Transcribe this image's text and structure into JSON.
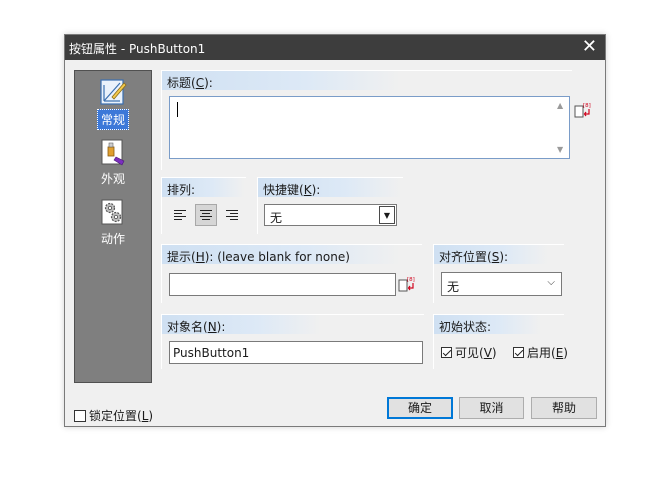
{
  "window": {
    "title": "按钮属性 - PushButton1",
    "close_glyph": "✕"
  },
  "categories": [
    {
      "label": "常规",
      "icon": "general-pencil-icon",
      "selected": true
    },
    {
      "label": "外观",
      "icon": "appearance-paint-icon",
      "selected": false
    },
    {
      "label": "动作",
      "icon": "action-gears-icon",
      "selected": false
    }
  ],
  "title_section": {
    "header_prefix": "标题(",
    "header_key": "C",
    "header_suffix": "):",
    "value": ""
  },
  "arrange_section": {
    "header": "排列:",
    "alignment": "center"
  },
  "shortcut_section": {
    "header_prefix": "快捷键(",
    "header_key": "K",
    "header_suffix": "):",
    "value": "无"
  },
  "tooltip_section": {
    "header_prefix": "提示(",
    "header_key": "H",
    "header_suffix": "): (leave blank for none)",
    "value": ""
  },
  "align_section": {
    "header_prefix": "对齐位置(",
    "header_key": "S",
    "header_suffix": "):",
    "value": "无"
  },
  "objname_section": {
    "header_prefix": "对象名(",
    "header_key": "N",
    "header_suffix": "):",
    "value": "PushButton1"
  },
  "initstate_section": {
    "header": "初始状态:",
    "visible": {
      "label_prefix": "可见(",
      "key": "V",
      "label_suffix": ")",
      "checked": true
    },
    "enabled": {
      "label_prefix": "启用(",
      "key": "E",
      "label_suffix": ")",
      "checked": true
    }
  },
  "lock": {
    "label_prefix": "锁定位置(",
    "key": "L",
    "label_suffix": ")",
    "checked": false
  },
  "buttons": {
    "ok": "确定",
    "cancel": "取消",
    "help": "帮助"
  },
  "colors": {
    "titlebar": "#3d3d3d",
    "section_header": "#cfe0f2",
    "selection": "#3c78d8",
    "default_button_border": "#0078d7"
  }
}
